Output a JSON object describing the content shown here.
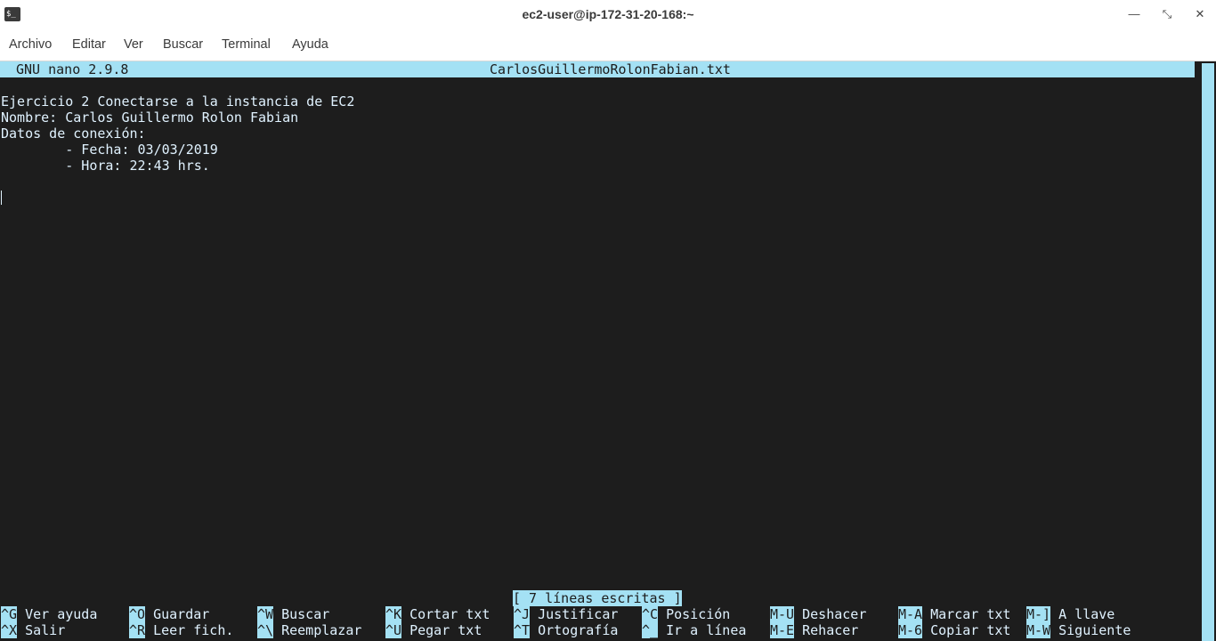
{
  "window": {
    "title": "ec2-user@ip-172-31-20-168:~",
    "icon_text": "$_",
    "minimize_glyph": "—",
    "maximize_glyph": "⤡",
    "close_glyph": "✕"
  },
  "menu": [
    "Archivo",
    "Editar",
    "Ver",
    "Buscar",
    "Terminal",
    "Ayuda"
  ],
  "nano": {
    "version": "GNU nano 2.9.8",
    "filename": "CarlosGuillermoRolonFabian.txt",
    "lines": [
      "",
      "Ejercicio 2 Conectarse a la instancia de EC2",
      "Nombre: Carlos Guillermo Rolon Fabian",
      "Datos de conexión:",
      "        - Fecha: 03/03/2019",
      "        - Hora: 22:43 hrs.",
      "",
      ""
    ],
    "status": "[ 7 líneas escritas ]",
    "shortcuts_row1": [
      {
        "key": "^G",
        "label": "Ver ayuda"
      },
      {
        "key": "^O",
        "label": "Guardar"
      },
      {
        "key": "^W",
        "label": "Buscar"
      },
      {
        "key": "^K",
        "label": "Cortar txt"
      },
      {
        "key": "^J",
        "label": "Justificar"
      },
      {
        "key": "^C",
        "label": "Posición"
      },
      {
        "key": "M-U",
        "label": "Deshacer"
      },
      {
        "key": "M-A",
        "label": "Marcar txt"
      },
      {
        "key": "M-]",
        "label": "A llave"
      }
    ],
    "shortcuts_row2": [
      {
        "key": "^X",
        "label": "Salir"
      },
      {
        "key": "^R",
        "label": "Leer fich."
      },
      {
        "key": "^\\",
        "label": "Reemplazar"
      },
      {
        "key": "^U",
        "label": "Pegar txt"
      },
      {
        "key": "^T",
        "label": "Ortografía"
      },
      {
        "key": "^_",
        "label": "Ir a línea"
      },
      {
        "key": "M-E",
        "label": "Rehacer"
      },
      {
        "key": "M-6",
        "label": "Copiar txt"
      },
      {
        "key": "M-W",
        "label": "Siguiente"
      }
    ]
  },
  "colors": {
    "terminal_bg": "#1d1d1d",
    "terminal_fg": "#e0f2ff",
    "highlight": "#a4e1f4"
  }
}
